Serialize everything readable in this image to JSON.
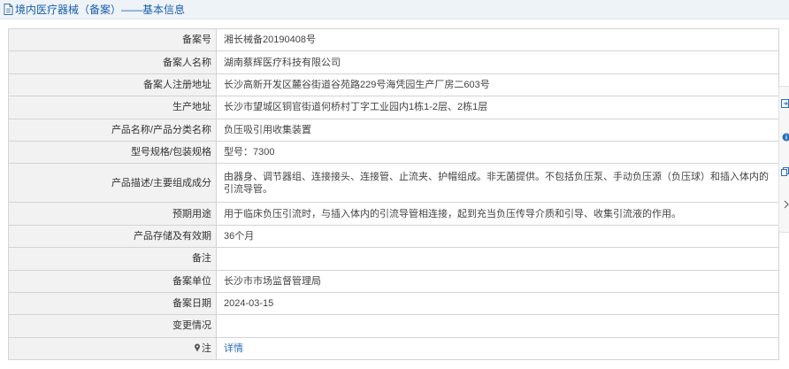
{
  "header": {
    "title": "境内医疗器械（备案）——基本信息"
  },
  "rows": [
    {
      "label": "备案号",
      "value": "湘长械备20190408号"
    },
    {
      "label": "备案人名称",
      "value": "湖南蔡辉医疗科技有限公司"
    },
    {
      "label": "备案人注册地址",
      "value": "长沙高新开发区麓谷街道谷苑路229号海凭园生产厂房二603号"
    },
    {
      "label": "生产地址",
      "value": "长沙市望城区铜官街道何桥村丁字工业园内1栋1-2层、2栋1层"
    },
    {
      "label": "产品名称/产品分类名称",
      "value": "负压吸引用收集装置"
    },
    {
      "label": "型号规格/包装规格",
      "value": "型号：7300"
    },
    {
      "label": "产品描述/主要组成成分",
      "value": "由器身、调节器组、连接接头、连接管、止流夹、护帽组成。非无菌提供。不包括负压泵、手动负压源（负压球）和插入体内的引流导管。"
    },
    {
      "label": "预期用途",
      "value": "用于临床负压引流时，与插入体内的引流导管相连接，起到充当负压传导介质和引导、收集引流液的作用。"
    },
    {
      "label": "产品存储及有效期",
      "value": "36个月"
    },
    {
      "label": "备注",
      "value": ""
    },
    {
      "label": "备案单位",
      "value": "长沙市市场监督管理局"
    },
    {
      "label": "备案日期",
      "value": "2024-03-15"
    },
    {
      "label": "变更情况",
      "value": ""
    }
  ],
  "note": {
    "label": "注",
    "link_text": "详情"
  },
  "icons": {
    "title": "document-icon",
    "note": "pin-icon",
    "side": [
      "export-icon",
      "help-icon",
      "copy-icon",
      "chevron-right-icon"
    ]
  },
  "colors": {
    "title_text": "#1a5fa8",
    "title_bar_bg": "#eef3f8",
    "label_bg": "#f2f2f2",
    "link": "#2a6ebb",
    "border": "#d4d4d4"
  }
}
